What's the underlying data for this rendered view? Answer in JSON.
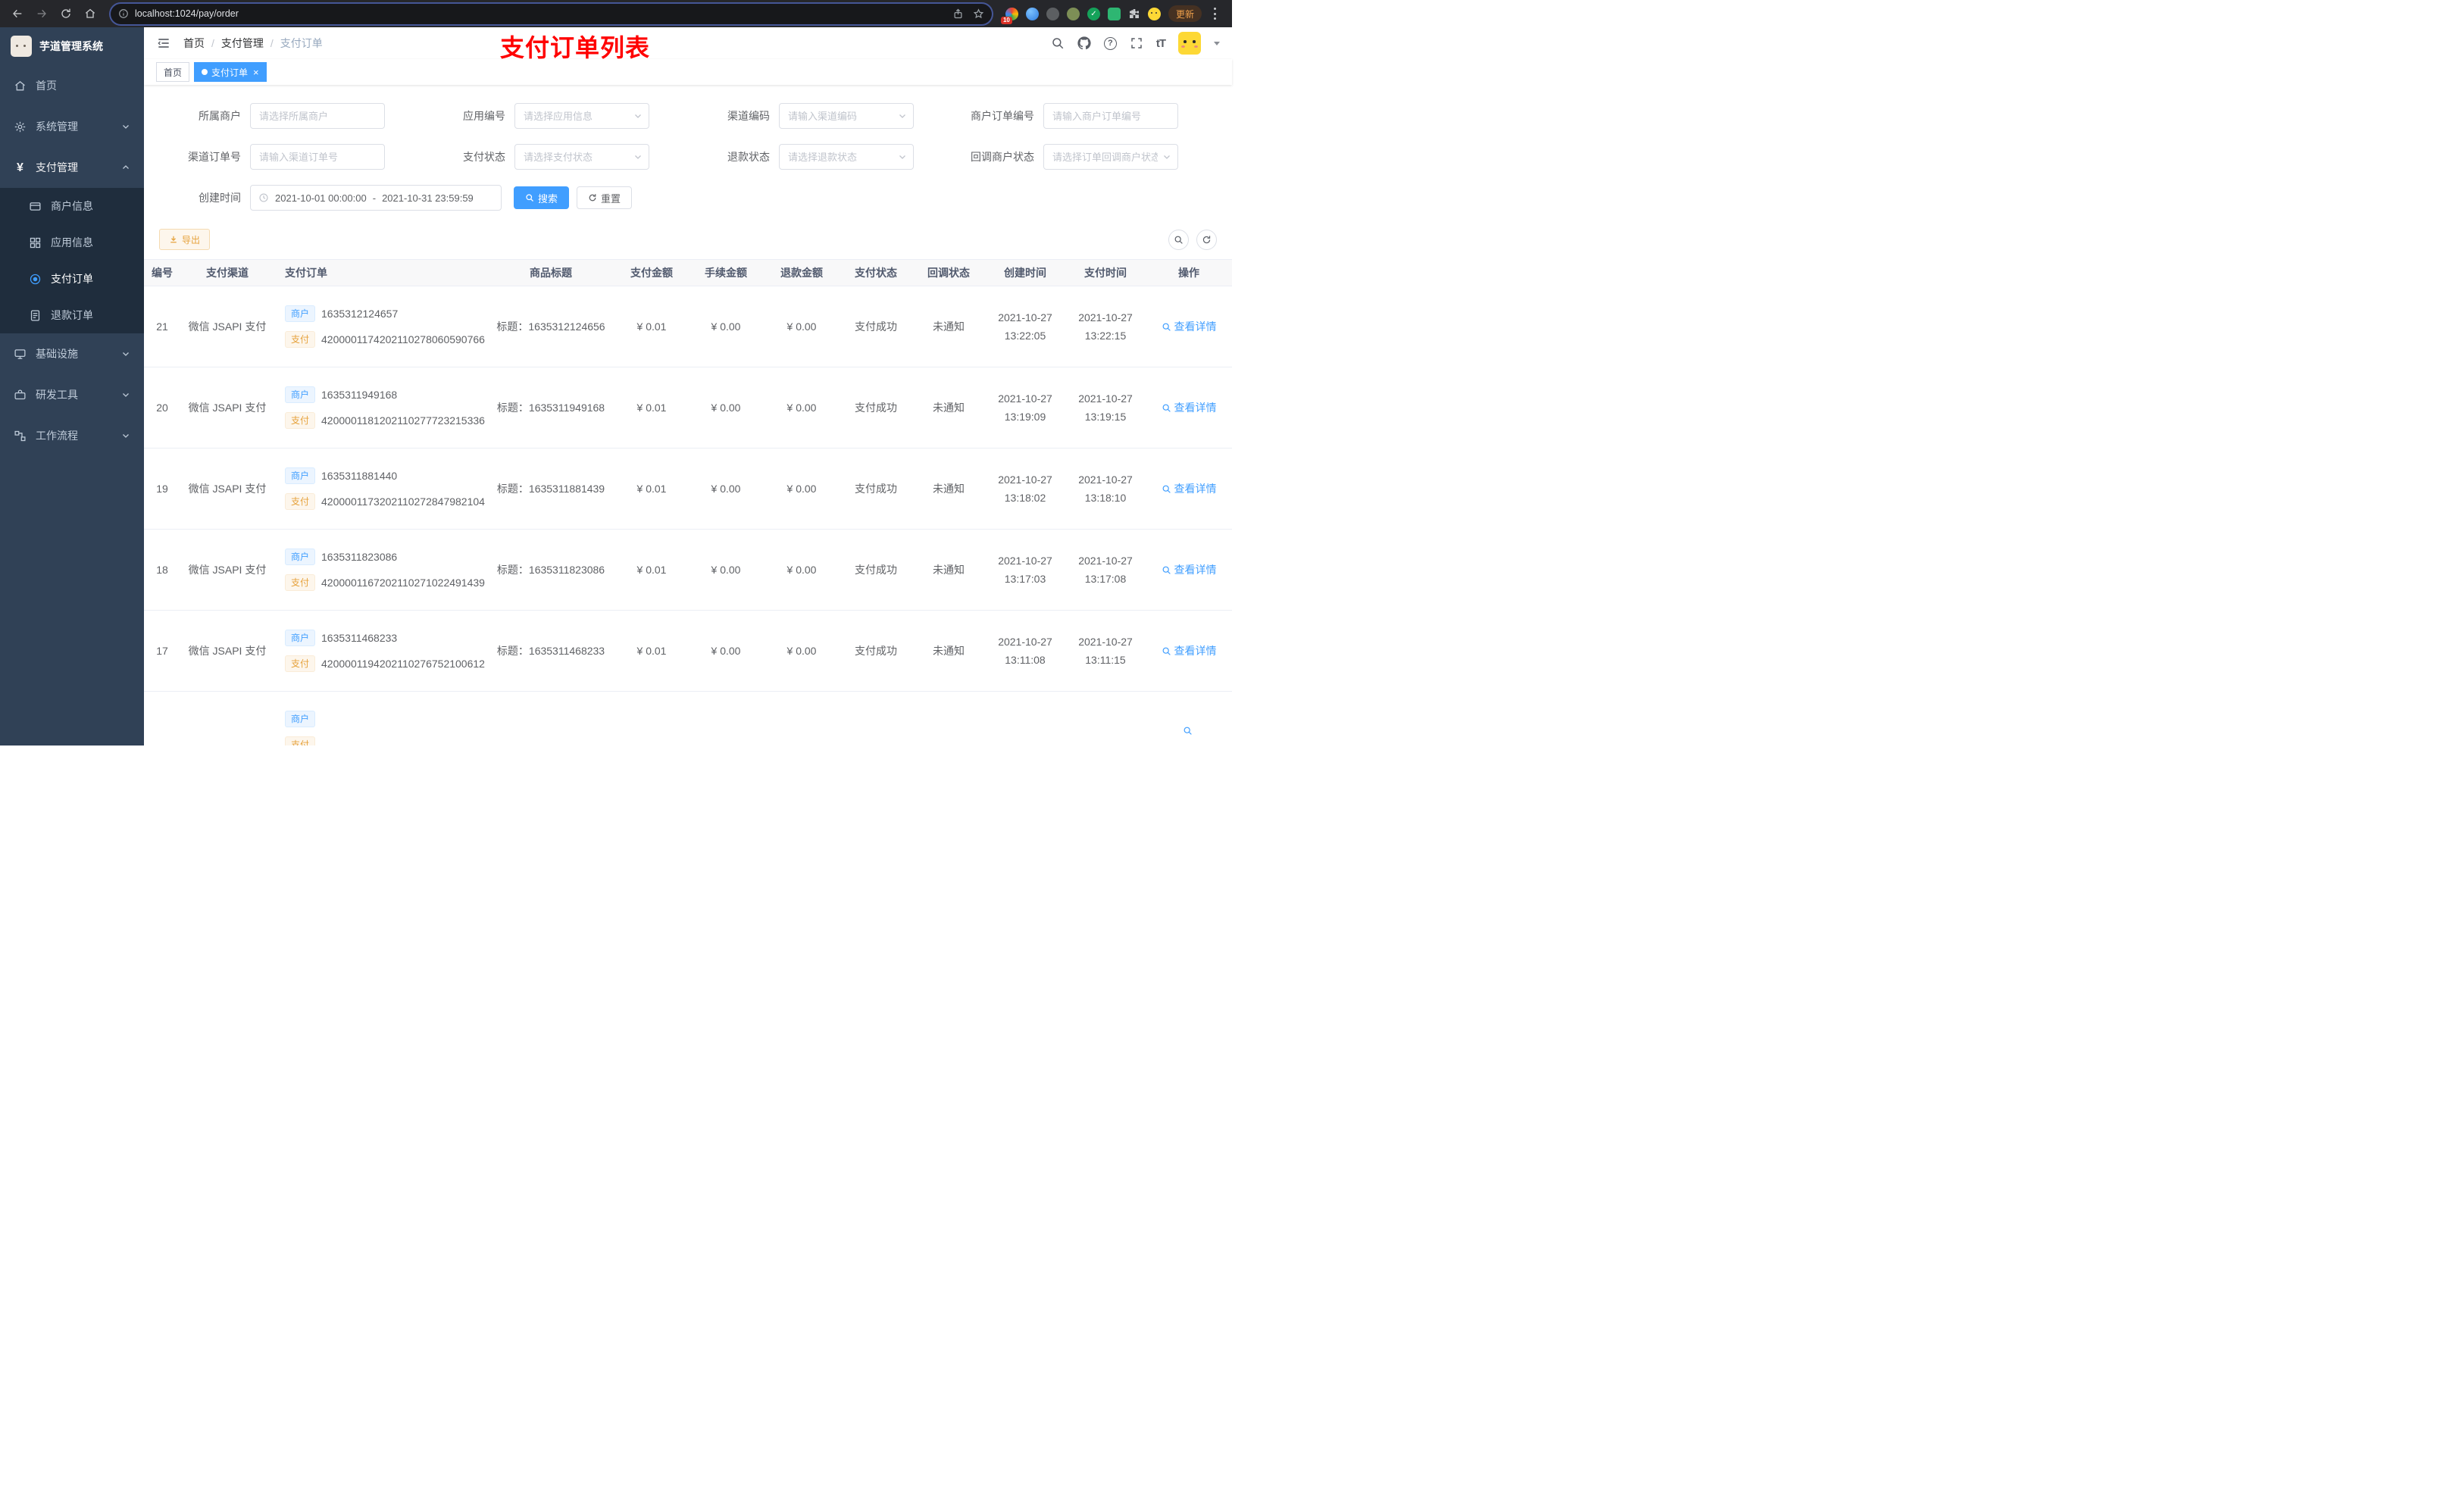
{
  "browser": {
    "url": "localhost:1024/pay/order",
    "update_label": "更新",
    "extension_badge": "10"
  },
  "sidebar": {
    "logo_title": "芋道管理系统",
    "home": "首页",
    "system": "系统管理",
    "payment": "支付管理",
    "merchant_info": "商户信息",
    "app_info": "应用信息",
    "pay_order": "支付订单",
    "refund_order": "退款订单",
    "infrastructure": "基础设施",
    "dev_tools": "研发工具",
    "workflow": "工作流程"
  },
  "header": {
    "breadcrumb": [
      "首页",
      "支付管理",
      "支付订单"
    ],
    "annotation": "支付订单列表"
  },
  "tabs": {
    "home": "首页",
    "current": "支付订单",
    "close": "×"
  },
  "filters": {
    "merchant": {
      "label": "所属商户",
      "placeholder": "请选择所属商户"
    },
    "app": {
      "label": "应用编号",
      "placeholder": "请选择应用信息"
    },
    "channel_code": {
      "label": "渠道编码",
      "placeholder": "请输入渠道编码"
    },
    "merchant_order_no": {
      "label": "商户订单编号",
      "placeholder": "请输入商户订单编号"
    },
    "channel_order_no": {
      "label": "渠道订单号",
      "placeholder": "请输入渠道订单号"
    },
    "pay_status": {
      "label": "支付状态",
      "placeholder": "请选择支付状态"
    },
    "refund_status": {
      "label": "退款状态",
      "placeholder": "请选择退款状态"
    },
    "notify_status": {
      "label": "回调商户状态",
      "placeholder": "请选择订单回调商户状态"
    },
    "create_time": {
      "label": "创建时间",
      "start": "2021-10-01 00:00:00",
      "separator": "-",
      "end": "2021-10-31 23:59:59"
    },
    "search": "搜索",
    "reset": "重置"
  },
  "toolbar": {
    "export": "导出"
  },
  "table": {
    "columns": [
      "编号",
      "支付渠道",
      "支付订单",
      "商品标题",
      "支付金额",
      "手续金额",
      "退款金额",
      "支付状态",
      "回调状态",
      "创建时间",
      "支付时间",
      "操作"
    ],
    "merchant_tag": "商户",
    "pay_tag": "支付",
    "rows": [
      {
        "id": "21",
        "channel": "微信 JSAPI 支付",
        "merchant_no": "1635312124657",
        "pay_no": "4200001174202110278060590766",
        "title": "标题：1635312124656",
        "amount": "¥ 0.01",
        "fee": "¥ 0.00",
        "refund": "¥ 0.00",
        "status": "支付成功",
        "notify": "未通知",
        "create_date": "2021-10-27",
        "create_time": "13:22:05",
        "pay_date": "2021-10-27",
        "pay_time": "13:22:15",
        "action": "查看详情"
      },
      {
        "id": "20",
        "channel": "微信 JSAPI 支付",
        "merchant_no": "1635311949168",
        "pay_no": "4200001181202110277723215336",
        "title": "标题：1635311949168",
        "amount": "¥ 0.01",
        "fee": "¥ 0.00",
        "refund": "¥ 0.00",
        "status": "支付成功",
        "notify": "未通知",
        "create_date": "2021-10-27",
        "create_time": "13:19:09",
        "pay_date": "2021-10-27",
        "pay_time": "13:19:15",
        "action": "查看详情"
      },
      {
        "id": "19",
        "channel": "微信 JSAPI 支付",
        "merchant_no": "1635311881440",
        "pay_no": "4200001173202110272847982104",
        "title": "标题：1635311881439",
        "amount": "¥ 0.01",
        "fee": "¥ 0.00",
        "refund": "¥ 0.00",
        "status": "支付成功",
        "notify": "未通知",
        "create_date": "2021-10-27",
        "create_time": "13:18:02",
        "pay_date": "2021-10-27",
        "pay_time": "13:18:10",
        "action": "查看详情"
      },
      {
        "id": "18",
        "channel": "微信 JSAPI 支付",
        "merchant_no": "1635311823086",
        "pay_no": "4200001167202110271022491439",
        "title": "标题：1635311823086",
        "amount": "¥ 0.01",
        "fee": "¥ 0.00",
        "refund": "¥ 0.00",
        "status": "支付成功",
        "notify": "未通知",
        "create_date": "2021-10-27",
        "create_time": "13:17:03",
        "pay_date": "2021-10-27",
        "pay_time": "13:17:08",
        "action": "查看详情"
      },
      {
        "id": "17",
        "channel": "微信 JSAPI 支付",
        "merchant_no": "1635311468233",
        "pay_no": "4200001194202110276752100612",
        "title": "标题：1635311468233",
        "amount": "¥ 0.01",
        "fee": "¥ 0.00",
        "refund": "¥ 0.00",
        "status": "支付成功",
        "notify": "未通知",
        "create_date": "2021-10-27",
        "create_time": "13:11:08",
        "pay_date": "2021-10-27",
        "pay_time": "13:11:15",
        "action": "查看详情"
      },
      {
        "id": "",
        "channel": "",
        "merchant_no": "",
        "pay_no": "",
        "title": "",
        "amount": "",
        "fee": "",
        "refund": "",
        "status": "",
        "notify": "",
        "create_date": "",
        "create_time": "",
        "pay_date": "",
        "pay_time": "",
        "action": ""
      }
    ]
  }
}
